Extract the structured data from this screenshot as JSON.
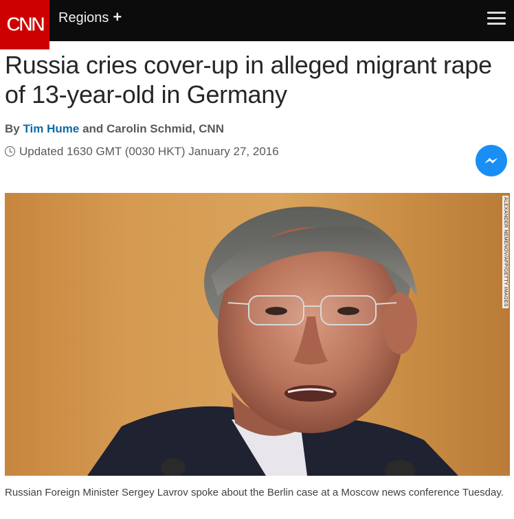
{
  "header": {
    "logo_text": "CNN",
    "regions_label": "Regions",
    "regions_plus": "+",
    "menu_icon": "hamburger-icon"
  },
  "article": {
    "headline": "Russia cries cover-up in alleged migrant rape of 13-year-old in Germany",
    "byline_prefix": "By",
    "author1": "Tim Hume",
    "byline_mid": "and Carolin Schmid, CNN",
    "updated": "Updated 1630 GMT (0030 HKT) January 27, 2016",
    "share_icon": "messenger-icon",
    "photo_credit": "ALEXANDER NEMENOV/AFP/GETTY IMAGES",
    "caption": "Russian Foreign Minister Sergey Lavrov spoke about the Berlin case at a Moscow news conference Tuesday."
  },
  "colors": {
    "brand_red": "#cc0000",
    "topbar": "#0c0c0c",
    "link_blue": "#0d6ba4",
    "messenger_blue": "#1a8ef5"
  }
}
